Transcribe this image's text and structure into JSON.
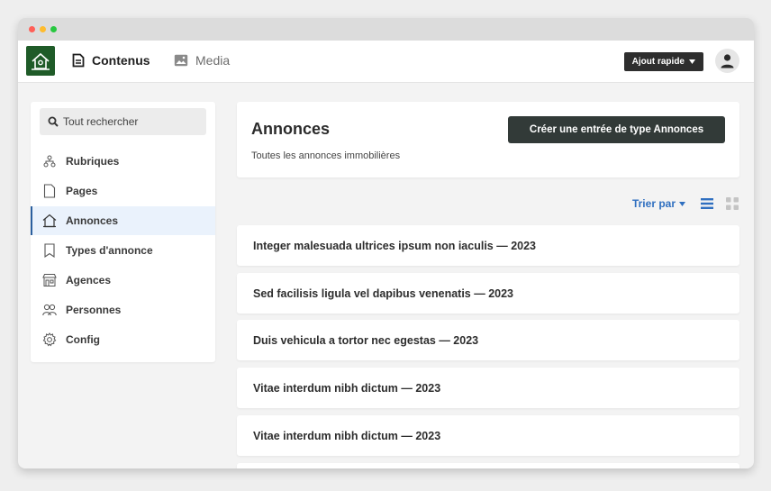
{
  "topnav": {
    "contenus_label": "Contenus",
    "media_label": "Media",
    "quick_add_label": "Ajout rapide"
  },
  "sidebar": {
    "search_placeholder": "Tout rechercher",
    "items": [
      {
        "label": "Rubriques",
        "icon": "hierarchy-icon"
      },
      {
        "label": "Pages",
        "icon": "page-icon"
      },
      {
        "label": "Annonces",
        "icon": "house-icon",
        "active": true
      },
      {
        "label": "Types d'annonce",
        "icon": "bookmark-icon"
      },
      {
        "label": "Agences",
        "icon": "store-icon"
      },
      {
        "label": "Personnes",
        "icon": "people-icon"
      },
      {
        "label": "Config",
        "icon": "gear-icon"
      }
    ]
  },
  "main": {
    "title": "Annonces",
    "subtitle": "Toutes les annonces immobilières",
    "create_button": "Créer une entrée de type Annonces",
    "sort_label": "Trier par",
    "listings": [
      "Integer malesuada ultrices ipsum non iaculis — 2023",
      "Sed facilisis ligula vel dapibus venenatis — 2023",
      "Duis vehicula a tortor nec egestas — 2023",
      "Vitae interdum nibh dictum — 2023",
      "Vitae interdum nibh dictum — 2023"
    ]
  },
  "colors": {
    "brand_green": "#1f5b28",
    "accent_blue": "#2f6fc0",
    "dark_button": "#323a38",
    "active_bg": "#eaf2fc"
  }
}
